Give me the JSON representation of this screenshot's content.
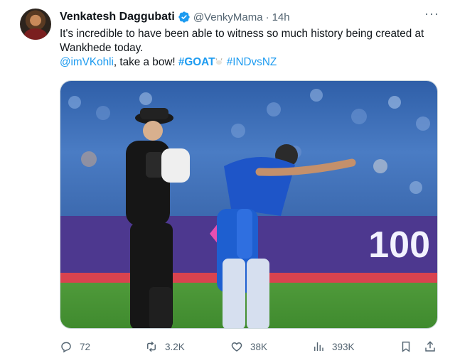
{
  "author": {
    "name": "Venkatesh Daggubati",
    "handle": "@VenkyMama",
    "separator": "·",
    "time": "14h",
    "verified": true
  },
  "more_label": "···",
  "tweet": {
    "line1": "It's incredible to have been able to witness so much history being created at Wankhede today.",
    "mention": "@imVKohli",
    "mid_text": ", take a bow! ",
    "hashtag1": "#GOAT",
    "hashtag2": "#INDvsNZ"
  },
  "media": {
    "board_text": "100",
    "accent_color": "#1d9bf0"
  },
  "actions": {
    "replies": "72",
    "reposts": "3.2K",
    "likes": "38K",
    "views": "393K"
  },
  "icons": [
    "reply-icon",
    "repost-icon",
    "like-icon",
    "views-icon",
    "bookmark-icon",
    "share-icon"
  ]
}
